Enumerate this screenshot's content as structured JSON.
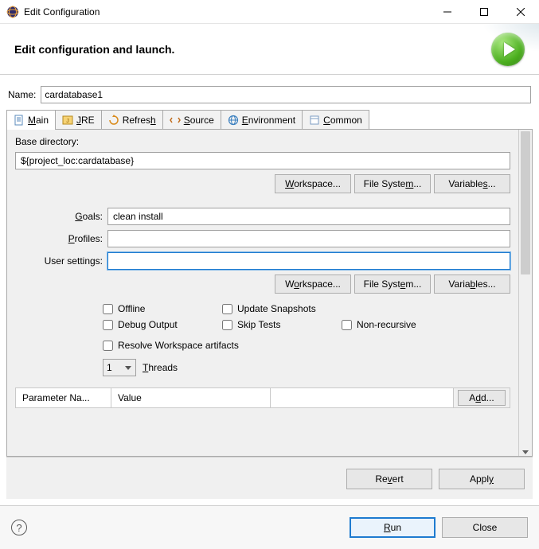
{
  "titlebar": {
    "title": "Edit Configuration"
  },
  "banner": {
    "title": "Edit configuration and launch."
  },
  "name": {
    "label": "Name:",
    "value": "cardatabase1"
  },
  "tabs": {
    "items": [
      {
        "label": "Main",
        "icon": "file-icon"
      },
      {
        "label": "JRE",
        "icon": "jre-icon"
      },
      {
        "label": "Refresh",
        "icon": "refresh-icon"
      },
      {
        "label": "Source",
        "icon": "source-icon"
      },
      {
        "label": "Environment",
        "icon": "environment-icon"
      },
      {
        "label": "Common",
        "icon": "common-icon"
      }
    ],
    "active": 0
  },
  "baseDirectory": {
    "label": "Base directory:",
    "value": "${project_loc:cardatabase}",
    "buttons": {
      "workspace": "Workspace...",
      "fileSystem": "File System...",
      "variables": "Variables..."
    }
  },
  "goals": {
    "label": "Goals:",
    "value": "clean install"
  },
  "profiles": {
    "label": "Profiles:",
    "value": ""
  },
  "userSettings": {
    "label": "User settings:",
    "value": "",
    "buttons": {
      "workspace": "Workspace...",
      "fileSystem": "File System...",
      "variables": "Variables..."
    }
  },
  "checks": {
    "offline": "Offline",
    "updateSnapshots": "Update Snapshots",
    "debugOutput": "Debug Output",
    "skipTests": "Skip Tests",
    "nonRecursive": "Non-recursive",
    "resolveWorkspace": "Resolve Workspace artifacts"
  },
  "threads": {
    "value": "1",
    "label": "Threads"
  },
  "paramTable": {
    "header1": "Parameter Na...",
    "header2": "Value",
    "addButton": "Add..."
  },
  "lowerButtons": {
    "revert": "Revert",
    "apply": "Apply"
  },
  "footer": {
    "run": "Run",
    "close": "Close"
  }
}
